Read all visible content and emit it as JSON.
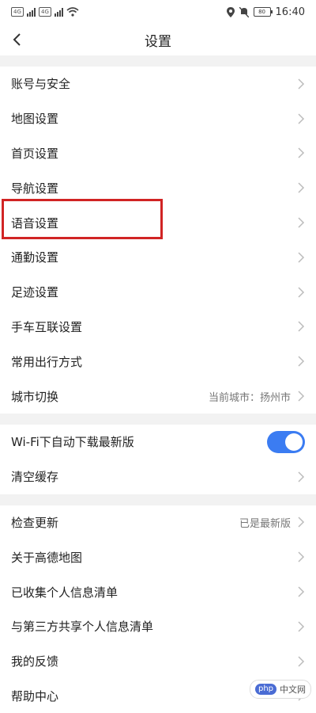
{
  "statusbar": {
    "time": "16:40",
    "battery": "80",
    "sim1": "4G",
    "sim2": "4G"
  },
  "header": {
    "title": "设置"
  },
  "group1": [
    {
      "label": "账号与安全"
    },
    {
      "label": "地图设置"
    },
    {
      "label": "首页设置"
    },
    {
      "label": "导航设置"
    },
    {
      "label": "语音设置"
    },
    {
      "label": "通勤设置"
    },
    {
      "label": "足迹设置"
    },
    {
      "label": "手车互联设置"
    },
    {
      "label": "常用出行方式"
    },
    {
      "label": "城市切换",
      "value": "当前城市：扬州市"
    }
  ],
  "group2": {
    "wifi_download": {
      "label": "Wi-Fi下自动下载最新版",
      "enabled": true
    },
    "clear_cache": {
      "label": "清空缓存"
    }
  },
  "group3": [
    {
      "label": "检查更新",
      "value": "已是最新版"
    },
    {
      "label": "关于高德地图"
    },
    {
      "label": "已收集个人信息清单"
    },
    {
      "label": "与第三方共享个人信息清单"
    },
    {
      "label": "我的反馈"
    },
    {
      "label": "帮助中心"
    }
  ],
  "watermark": {
    "brand": "php",
    "text": "中文网"
  },
  "colors": {
    "toggle_on": "#3b7cf2",
    "highlight": "#d12424"
  },
  "icons": {
    "back": "chevron-left-icon",
    "row_arrow": "chevron-right-icon"
  }
}
